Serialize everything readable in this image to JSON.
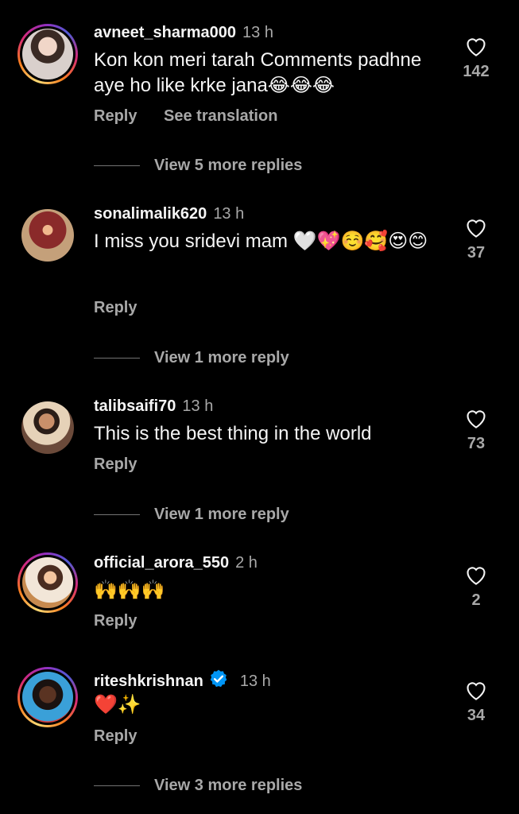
{
  "colors": {
    "background": "#000000",
    "text": "#f5f5f5",
    "secondary": "#a8a8a8",
    "verified": "#0095f6"
  },
  "comments": [
    {
      "username": "avneet_sharma000",
      "time": "13 h",
      "text": "Kon kon meri tarah Comments padhne aye ho like krke jana😂😂😂",
      "reply_label": "Reply",
      "translate_label": "See translation",
      "likes": "142",
      "view_more": "View 5 more replies",
      "story_ring": true
    },
    {
      "username": "sonalimalik620",
      "time": "13 h",
      "text": "I miss you sridevi mam 🤍💖☺️🥰😍😊",
      "reply_label": "Reply",
      "likes": "37",
      "view_more": "View 1 more reply",
      "story_ring": false
    },
    {
      "username": "talibsaifi70",
      "time": "13 h",
      "text": "This is the best thing in the world",
      "reply_label": "Reply",
      "likes": "73",
      "view_more": "View 1 more reply",
      "story_ring": false
    },
    {
      "username": "official_arora_550",
      "time": "2 h",
      "text": "🙌🙌🙌",
      "reply_label": "Reply",
      "likes": "2",
      "story_ring": true
    },
    {
      "username": "riteshkrishnan",
      "time": "13 h",
      "verified": true,
      "text": "❤️✨",
      "reply_label": "Reply",
      "likes": "34",
      "view_more": "View 3 more replies",
      "story_ring": true
    }
  ],
  "icons": {
    "like": "heart-outline-icon",
    "verified": "verified-badge-icon",
    "avatar": "avatar-photo"
  }
}
